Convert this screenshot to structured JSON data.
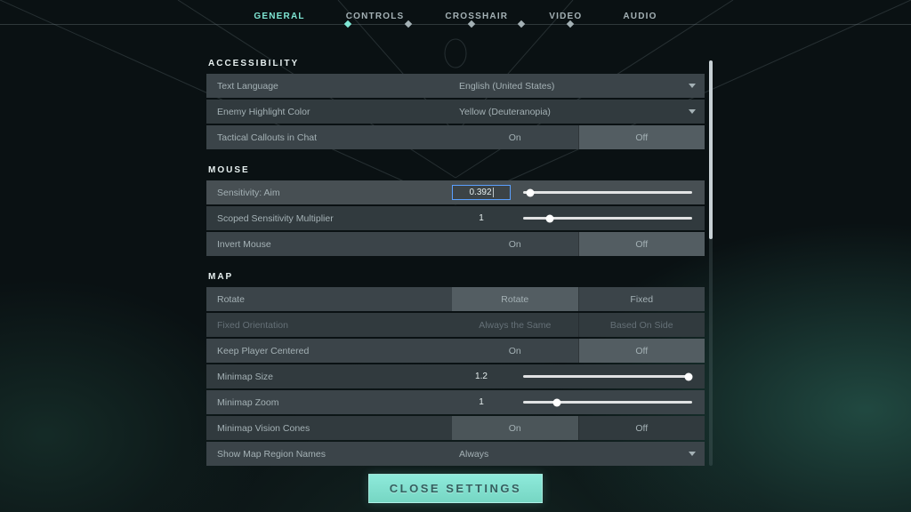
{
  "tabs": [
    "GENERAL",
    "CONTROLS",
    "CROSSHAIR",
    "VIDEO",
    "AUDIO"
  ],
  "active_tab": 0,
  "close_label": "CLOSE SETTINGS",
  "sections": {
    "accessibility": {
      "title": "ACCESSIBILITY",
      "text_language": {
        "label": "Text Language",
        "value": "English (United States)"
      },
      "enemy_highlight": {
        "label": "Enemy Highlight Color",
        "value": "Yellow (Deuteranopia)"
      },
      "tactical_callouts": {
        "label": "Tactical Callouts in Chat",
        "on": "On",
        "off": "Off",
        "selected": "off"
      }
    },
    "mouse": {
      "title": "MOUSE",
      "sens": {
        "label": "Sensitivity: Aim",
        "value": "0.392",
        "pct": 4
      },
      "scoped": {
        "label": "Scoped Sensitivity Multiplier",
        "value": "1",
        "pct": 16
      },
      "invert": {
        "label": "Invert Mouse",
        "on": "On",
        "off": "Off",
        "selected": "off"
      }
    },
    "map": {
      "title": "MAP",
      "rotate": {
        "label": "Rotate",
        "a": "Rotate",
        "b": "Fixed",
        "selected": "a"
      },
      "fixed_orientation": {
        "label": "Fixed Orientation",
        "a": "Always the Same",
        "b": "Based On Side",
        "disabled": true
      },
      "keep_centered": {
        "label": "Keep Player Centered",
        "on": "On",
        "off": "Off",
        "selected": "off"
      },
      "mm_size": {
        "label": "Minimap Size",
        "value": "1.2",
        "pct": 98
      },
      "mm_zoom": {
        "label": "Minimap Zoom",
        "value": "1",
        "pct": 20
      },
      "vision_cones": {
        "label": "Minimap Vision Cones",
        "on": "On",
        "off": "Off",
        "selected": "on"
      },
      "region_names": {
        "label": "Show Map Region Names",
        "value": "Always"
      }
    }
  }
}
